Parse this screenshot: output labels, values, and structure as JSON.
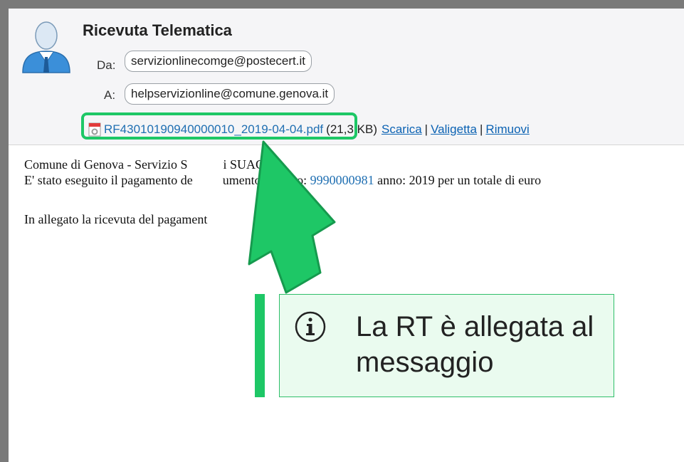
{
  "email": {
    "subject": "Ricevuta Telematica",
    "from_label": "Da:",
    "from_value": "servizionlinecomge@postecert.it",
    "to_label": "A:",
    "to_value": "helpservizionline@comune.genova.it"
  },
  "attachment": {
    "filename": "RF43010190940000010_2019-04-04.pdf",
    "size": "(21,3 KB)",
    "download": "Scarica",
    "briefcase": "Valigetta",
    "remove": "Rimuovi",
    "separator": "|"
  },
  "body": {
    "line1": "Comune di Genova - Servizio S",
    "line1_end": "i SUAC",
    "line2_start": "E' stato eseguito il pagamento de",
    "line2_mid": "umento numero:",
    "number": "9990000981",
    "line2_end": "anno: 2019 per un totale di euro",
    "line3": "In allegato la ricevuta del pagament"
  },
  "callout": {
    "text": "La RT è allegata al messaggio",
    "icon": "info-icon"
  },
  "colors": {
    "accent_green": "#1ec766",
    "link_blue": "#0b62b3"
  }
}
